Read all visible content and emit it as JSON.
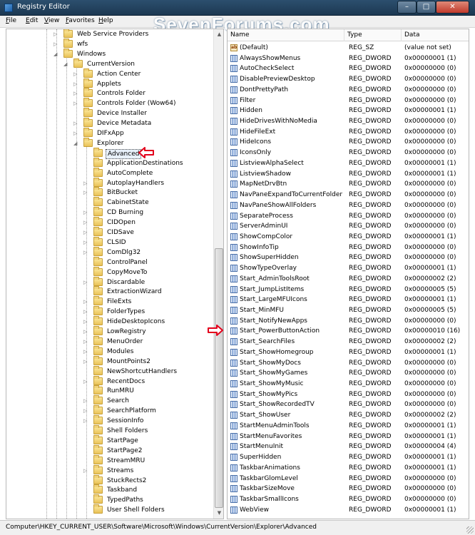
{
  "window": {
    "title": "Registry Editor",
    "min": "–",
    "max": "□",
    "close": "✕"
  },
  "watermark": "SevenForums.com",
  "menu": [
    "File",
    "Edit",
    "View",
    "Favorites",
    "Help"
  ],
  "tree": [
    {
      "label": "Web Service Providers",
      "level": 0,
      "arrow": "▷"
    },
    {
      "label": "wfs",
      "level": 0,
      "arrow": "▷"
    },
    {
      "label": "Windows",
      "level": 0,
      "arrow": "◢"
    },
    {
      "label": "CurrentVersion",
      "level": 1,
      "arrow": "◢"
    },
    {
      "label": "Action Center",
      "level": 2,
      "arrow": "▷"
    },
    {
      "label": "Applets",
      "level": 2,
      "arrow": "▷"
    },
    {
      "label": "Controls Folder",
      "level": 2,
      "arrow": "▷"
    },
    {
      "label": "Controls Folder (Wow64)",
      "level": 2,
      "arrow": "▷"
    },
    {
      "label": "Device Installer",
      "level": 2,
      "arrow": ""
    },
    {
      "label": "Device Metadata",
      "level": 2,
      "arrow": "▷"
    },
    {
      "label": "DIFxApp",
      "level": 2,
      "arrow": "▷"
    },
    {
      "label": "Explorer",
      "level": 2,
      "arrow": "◢"
    },
    {
      "label": "Advanced",
      "level": 3,
      "arrow": "",
      "selected": true
    },
    {
      "label": "ApplicationDestinations",
      "level": 3,
      "arrow": ""
    },
    {
      "label": "AutoComplete",
      "level": 3,
      "arrow": ""
    },
    {
      "label": "AutoplayHandlers",
      "level": 3,
      "arrow": "▷"
    },
    {
      "label": "BitBucket",
      "level": 3,
      "arrow": "▷"
    },
    {
      "label": "CabinetState",
      "level": 3,
      "arrow": ""
    },
    {
      "label": "CD Burning",
      "level": 3,
      "arrow": "▷"
    },
    {
      "label": "CIDOpen",
      "level": 3,
      "arrow": "▷"
    },
    {
      "label": "CIDSave",
      "level": 3,
      "arrow": "▷"
    },
    {
      "label": "CLSID",
      "level": 3,
      "arrow": "▷"
    },
    {
      "label": "ComDlg32",
      "level": 3,
      "arrow": "▷"
    },
    {
      "label": "ControlPanel",
      "level": 3,
      "arrow": ""
    },
    {
      "label": "CopyMoveTo",
      "level": 3,
      "arrow": ""
    },
    {
      "label": "Discardable",
      "level": 3,
      "arrow": "▷"
    },
    {
      "label": "ExtractionWizard",
      "level": 3,
      "arrow": ""
    },
    {
      "label": "FileExts",
      "level": 3,
      "arrow": "▷"
    },
    {
      "label": "FolderTypes",
      "level": 3,
      "arrow": "▷"
    },
    {
      "label": "HideDesktopIcons",
      "level": 3,
      "arrow": "▷"
    },
    {
      "label": "LowRegistry",
      "level": 3,
      "arrow": "▷"
    },
    {
      "label": "MenuOrder",
      "level": 3,
      "arrow": "▷"
    },
    {
      "label": "Modules",
      "level": 3,
      "arrow": "▷"
    },
    {
      "label": "MountPoints2",
      "level": 3,
      "arrow": "▷"
    },
    {
      "label": "NewShortcutHandlers",
      "level": 3,
      "arrow": ""
    },
    {
      "label": "RecentDocs",
      "level": 3,
      "arrow": "▷"
    },
    {
      "label": "RunMRU",
      "level": 3,
      "arrow": ""
    },
    {
      "label": "Search",
      "level": 3,
      "arrow": "▷"
    },
    {
      "label": "SearchPlatform",
      "level": 3,
      "arrow": "▷"
    },
    {
      "label": "SessionInfo",
      "level": 3,
      "arrow": "▷"
    },
    {
      "label": "Shell Folders",
      "level": 3,
      "arrow": ""
    },
    {
      "label": "StartPage",
      "level": 3,
      "arrow": ""
    },
    {
      "label": "StartPage2",
      "level": 3,
      "arrow": ""
    },
    {
      "label": "StreamMRU",
      "level": 3,
      "arrow": ""
    },
    {
      "label": "Streams",
      "level": 3,
      "arrow": "▷"
    },
    {
      "label": "StuckRects2",
      "level": 3,
      "arrow": ""
    },
    {
      "label": "Taskband",
      "level": 3,
      "arrow": ""
    },
    {
      "label": "TypedPaths",
      "level": 3,
      "arrow": ""
    },
    {
      "label": "User Shell Folders",
      "level": 3,
      "arrow": ""
    }
  ],
  "values_header": {
    "name": "Name",
    "type": "Type",
    "data": "Data"
  },
  "values": [
    {
      "name": "(Default)",
      "type": "REG_SZ",
      "data": "(value not set)",
      "kind": "sz"
    },
    {
      "name": "AlwaysShowMenus",
      "type": "REG_DWORD",
      "data": "0x00000001 (1)"
    },
    {
      "name": "AutoCheckSelect",
      "type": "REG_DWORD",
      "data": "0x00000000 (0)"
    },
    {
      "name": "DisablePreviewDesktop",
      "type": "REG_DWORD",
      "data": "0x00000000 (0)"
    },
    {
      "name": "DontPrettyPath",
      "type": "REG_DWORD",
      "data": "0x00000000 (0)"
    },
    {
      "name": "Filter",
      "type": "REG_DWORD",
      "data": "0x00000000 (0)"
    },
    {
      "name": "Hidden",
      "type": "REG_DWORD",
      "data": "0x00000001 (1)"
    },
    {
      "name": "HideDrivesWithNoMedia",
      "type": "REG_DWORD",
      "data": "0x00000000 (0)"
    },
    {
      "name": "HideFileExt",
      "type": "REG_DWORD",
      "data": "0x00000000 (0)"
    },
    {
      "name": "HideIcons",
      "type": "REG_DWORD",
      "data": "0x00000000 (0)"
    },
    {
      "name": "IconsOnly",
      "type": "REG_DWORD",
      "data": "0x00000000 (0)"
    },
    {
      "name": "ListviewAlphaSelect",
      "type": "REG_DWORD",
      "data": "0x00000001 (1)"
    },
    {
      "name": "ListviewShadow",
      "type": "REG_DWORD",
      "data": "0x00000001 (1)"
    },
    {
      "name": "MapNetDrvBtn",
      "type": "REG_DWORD",
      "data": "0x00000000 (0)"
    },
    {
      "name": "NavPaneExpandToCurrentFolder",
      "type": "REG_DWORD",
      "data": "0x00000000 (0)"
    },
    {
      "name": "NavPaneShowAllFolders",
      "type": "REG_DWORD",
      "data": "0x00000000 (0)"
    },
    {
      "name": "SeparateProcess",
      "type": "REG_DWORD",
      "data": "0x00000000 (0)"
    },
    {
      "name": "ServerAdminUI",
      "type": "REG_DWORD",
      "data": "0x00000000 (0)"
    },
    {
      "name": "ShowCompColor",
      "type": "REG_DWORD",
      "data": "0x00000001 (1)"
    },
    {
      "name": "ShowInfoTip",
      "type": "REG_DWORD",
      "data": "0x00000000 (0)"
    },
    {
      "name": "ShowSuperHidden",
      "type": "REG_DWORD",
      "data": "0x00000000 (0)"
    },
    {
      "name": "ShowTypeOverlay",
      "type": "REG_DWORD",
      "data": "0x00000001 (1)"
    },
    {
      "name": "Start_AdminToolsRoot",
      "type": "REG_DWORD",
      "data": "0x00000002 (2)"
    },
    {
      "name": "Start_JumpListItems",
      "type": "REG_DWORD",
      "data": "0x00000005 (5)"
    },
    {
      "name": "Start_LargeMFUIcons",
      "type": "REG_DWORD",
      "data": "0x00000001 (1)"
    },
    {
      "name": "Start_MinMFU",
      "type": "REG_DWORD",
      "data": "0x00000005 (5)"
    },
    {
      "name": "Start_NotifyNewApps",
      "type": "REG_DWORD",
      "data": "0x00000000 (0)"
    },
    {
      "name": "Start_PowerButtonAction",
      "type": "REG_DWORD",
      "data": "0x00000010 (16)"
    },
    {
      "name": "Start_SearchFiles",
      "type": "REG_DWORD",
      "data": "0x00000002 (2)"
    },
    {
      "name": "Start_ShowHomegroup",
      "type": "REG_DWORD",
      "data": "0x00000001 (1)"
    },
    {
      "name": "Start_ShowMyDocs",
      "type": "REG_DWORD",
      "data": "0x00000000 (0)"
    },
    {
      "name": "Start_ShowMyGames",
      "type": "REG_DWORD",
      "data": "0x00000000 (0)"
    },
    {
      "name": "Start_ShowMyMusic",
      "type": "REG_DWORD",
      "data": "0x00000000 (0)"
    },
    {
      "name": "Start_ShowMyPics",
      "type": "REG_DWORD",
      "data": "0x00000000 (0)"
    },
    {
      "name": "Start_ShowRecordedTV",
      "type": "REG_DWORD",
      "data": "0x00000000 (0)"
    },
    {
      "name": "Start_ShowUser",
      "type": "REG_DWORD",
      "data": "0x00000002 (2)"
    },
    {
      "name": "StartMenuAdminTools",
      "type": "REG_DWORD",
      "data": "0x00000001 (1)"
    },
    {
      "name": "StartMenuFavorites",
      "type": "REG_DWORD",
      "data": "0x00000001 (1)"
    },
    {
      "name": "StartMenuInit",
      "type": "REG_DWORD",
      "data": "0x00000004 (4)"
    },
    {
      "name": "SuperHidden",
      "type": "REG_DWORD",
      "data": "0x00000001 (1)"
    },
    {
      "name": "TaskbarAnimations",
      "type": "REG_DWORD",
      "data": "0x00000001 (1)"
    },
    {
      "name": "TaskbarGlomLevel",
      "type": "REG_DWORD",
      "data": "0x00000000 (0)"
    },
    {
      "name": "TaskbarSizeMove",
      "type": "REG_DWORD",
      "data": "0x00000000 (0)"
    },
    {
      "name": "TaskbarSmallIcons",
      "type": "REG_DWORD",
      "data": "0x00000000 (0)"
    },
    {
      "name": "WebView",
      "type": "REG_DWORD",
      "data": "0x00000001 (1)"
    }
  ],
  "statusbar": {
    "path": "Computer\\HKEY_CURRENT_USER\\Software\\Microsoft\\Windows\\CurrentVersion\\Explorer\\Advanced"
  },
  "colors": {
    "arrow": "#e3001b",
    "titlebar": "#2c4f6e"
  }
}
